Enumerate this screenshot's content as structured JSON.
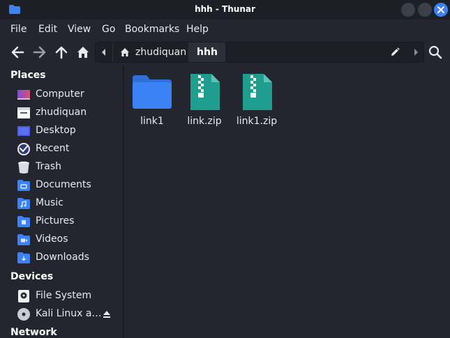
{
  "window": {
    "title": "hhh - Thunar"
  },
  "menu": [
    "File",
    "Edit",
    "View",
    "Go",
    "Bookmarks",
    "Help"
  ],
  "path": {
    "home_label": "zhudiquan",
    "current_label": "hhh"
  },
  "sidebar": {
    "places_label": "Places",
    "places": [
      {
        "label": "Computer",
        "icon": "computer-icon"
      },
      {
        "label": "zhudiquan",
        "icon": "home-folder-icon"
      },
      {
        "label": "Desktop",
        "icon": "desktop-folder-icon"
      },
      {
        "label": "Recent",
        "icon": "recent-icon"
      },
      {
        "label": "Trash",
        "icon": "trash-icon"
      },
      {
        "label": "Documents",
        "icon": "documents-folder-icon"
      },
      {
        "label": "Music",
        "icon": "music-folder-icon"
      },
      {
        "label": "Pictures",
        "icon": "pictures-folder-icon"
      },
      {
        "label": "Videos",
        "icon": "videos-folder-icon"
      },
      {
        "label": "Downloads",
        "icon": "downloads-folder-icon"
      }
    ],
    "devices_label": "Devices",
    "devices": [
      {
        "label": "File System",
        "icon": "harddisk-icon"
      },
      {
        "label": "Kali Linux a…",
        "icon": "optical-disc-icon"
      }
    ],
    "network_label": "Network"
  },
  "files": [
    {
      "name": "link1",
      "icon": "folder-icon"
    },
    {
      "name": "link.zip",
      "icon": "zip-archive-icon"
    },
    {
      "name": "link1.zip",
      "icon": "zip-archive-icon"
    }
  ],
  "colors": {
    "accent": "#3b82f6",
    "folder": "#3b82f6",
    "archive": "#1f9e8f"
  }
}
